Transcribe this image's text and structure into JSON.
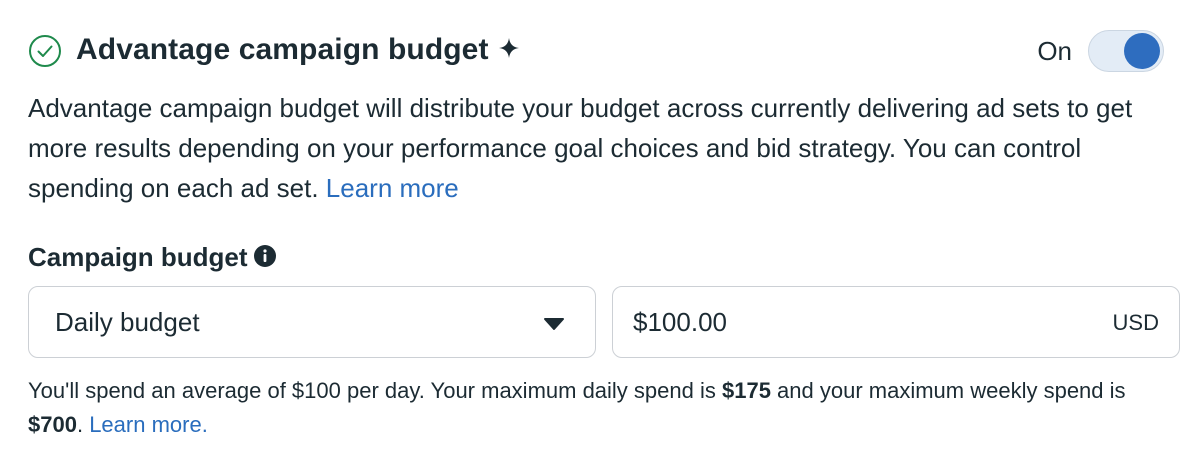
{
  "header": {
    "title": "Advantage campaign budget",
    "toggle_label": "On",
    "toggle_on": true,
    "icons": [
      "check-circle-icon",
      "sparkle-icon"
    ]
  },
  "description": {
    "text": "Advantage campaign budget will distribute your budget across currently delivering ad sets to get more results depending on your performance goal choices and bid strategy. You can control spending on each ad set. ",
    "link": "Learn more"
  },
  "budget": {
    "label": "Campaign budget",
    "info_icon": "info-icon",
    "type_value": "Daily budget",
    "amount_value": "$100.00",
    "currency": "USD"
  },
  "help": {
    "part1": "You'll spend an average of $100 per day. Your maximum daily spend is ",
    "daily_max": "$175",
    "part2": " and your maximum weekly spend is ",
    "weekly_max": "$700",
    "part3": ". ",
    "link": "Learn more."
  },
  "colors": {
    "text": "#1c2b33",
    "link": "#2a6dbd",
    "toggle_knob": "#2e6dbf",
    "toggle_track": "#e3ecf6",
    "check": "#1f8a4c",
    "border": "#ccd0d5"
  }
}
